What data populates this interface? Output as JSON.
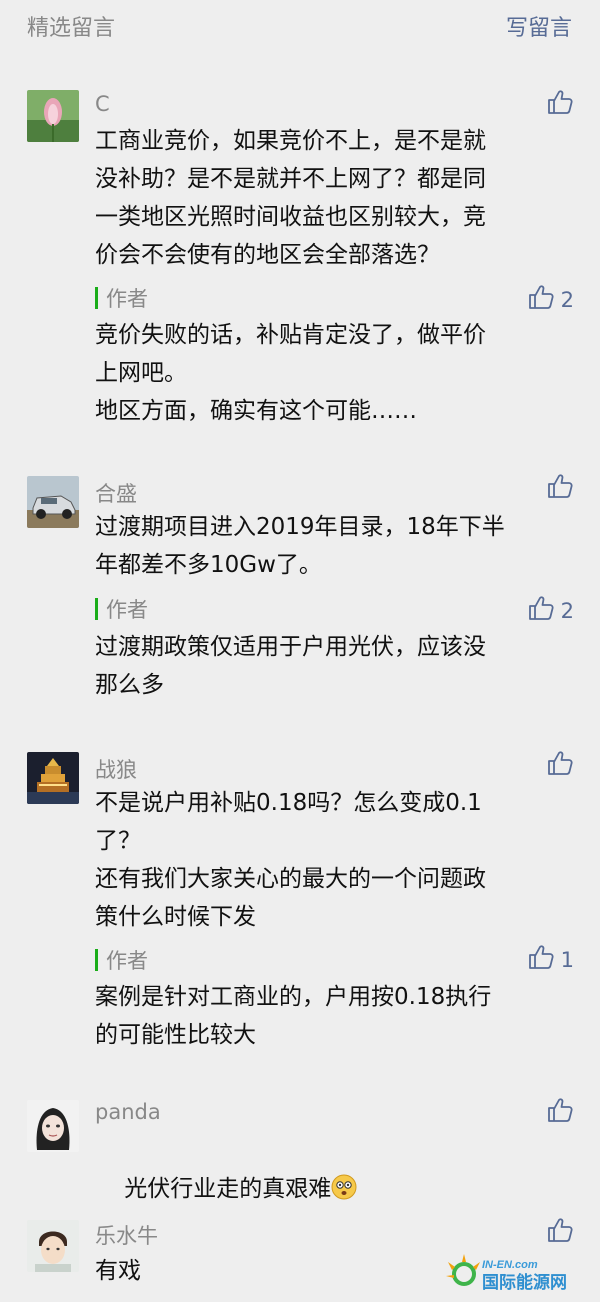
{
  "header": {
    "title": "精选留言",
    "write_label": "写留言"
  },
  "comments": [
    {
      "nickname": "C",
      "text": "工商业竞价，如果竞价不上，是不是就\n没补助？是不是就并不上网了？都是同\n一类地区光照时间收益也区别较大，竞\n价会不会使有的地区会全部落选？",
      "likes": "",
      "reply": {
        "label": "作者",
        "likes": "2",
        "text": "竞价失败的话，补贴肯定没了，做平价\n上网吧。\n地区方面，确实有这个可能……"
      }
    },
    {
      "nickname": "合盛",
      "text": "过渡期项目进入2019年目录，18年下半\n年都差不多10Gw了。",
      "likes": "",
      "reply": {
        "label": "作者",
        "likes": "2",
        "text": "过渡期政策仅适用于户用光伏，应该没\n那么多"
      }
    },
    {
      "nickname": "战狼",
      "text": "不是说户用补贴0.18吗？怎么变成0.1\n了？\n还有我们大家关心的最大的一个问题政\n策什么时候下发",
      "likes": "",
      "reply": {
        "label": "作者",
        "likes": "1",
        "text": "案例是针对工商业的，户用按0.18执行\n的可能性比较大"
      }
    },
    {
      "nickname": "panda",
      "text": "光伏行业走的真艰难",
      "likes": ""
    },
    {
      "nickname": "乐水牛",
      "text": "有戏",
      "likes": ""
    }
  ],
  "watermark": {
    "brand_top": "IN-EN.com",
    "brand_bottom": "国际能源网"
  },
  "colors": {
    "link": "#576b95",
    "author_bar": "#1aad19",
    "muted": "#888888",
    "background": "#eeeeee"
  }
}
